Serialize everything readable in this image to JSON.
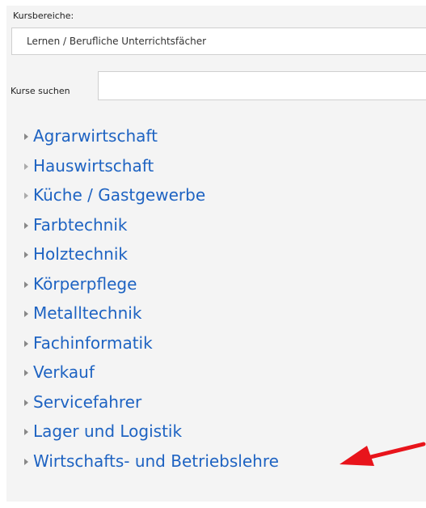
{
  "filter": {
    "label": "Kursbereiche:",
    "selected": "Lernen / Berufliche Unterrichtsfächer"
  },
  "search": {
    "label": "Kurse suchen",
    "value": ""
  },
  "categories": [
    {
      "label": "Agrarwirtschaft"
    },
    {
      "label": "Hauswirtschaft"
    },
    {
      "label": "Küche / Gastgewerbe"
    },
    {
      "label": "Farbtechnik"
    },
    {
      "label": "Holztechnik"
    },
    {
      "label": "Körperpflege"
    },
    {
      "label": "Metalltechnik"
    },
    {
      "label": "Fachinformatik"
    },
    {
      "label": "Verkauf"
    },
    {
      "label": "Servicefahrer"
    },
    {
      "label": "Lager und Logistik"
    },
    {
      "label": "Wirtschafts- und Betriebslehre"
    }
  ],
  "colors": {
    "link": "#1e63c2",
    "annotation_arrow": "#e8141b"
  },
  "icons": {
    "expand": "triangle-right-icon",
    "annotation": "red-arrow-icon"
  }
}
